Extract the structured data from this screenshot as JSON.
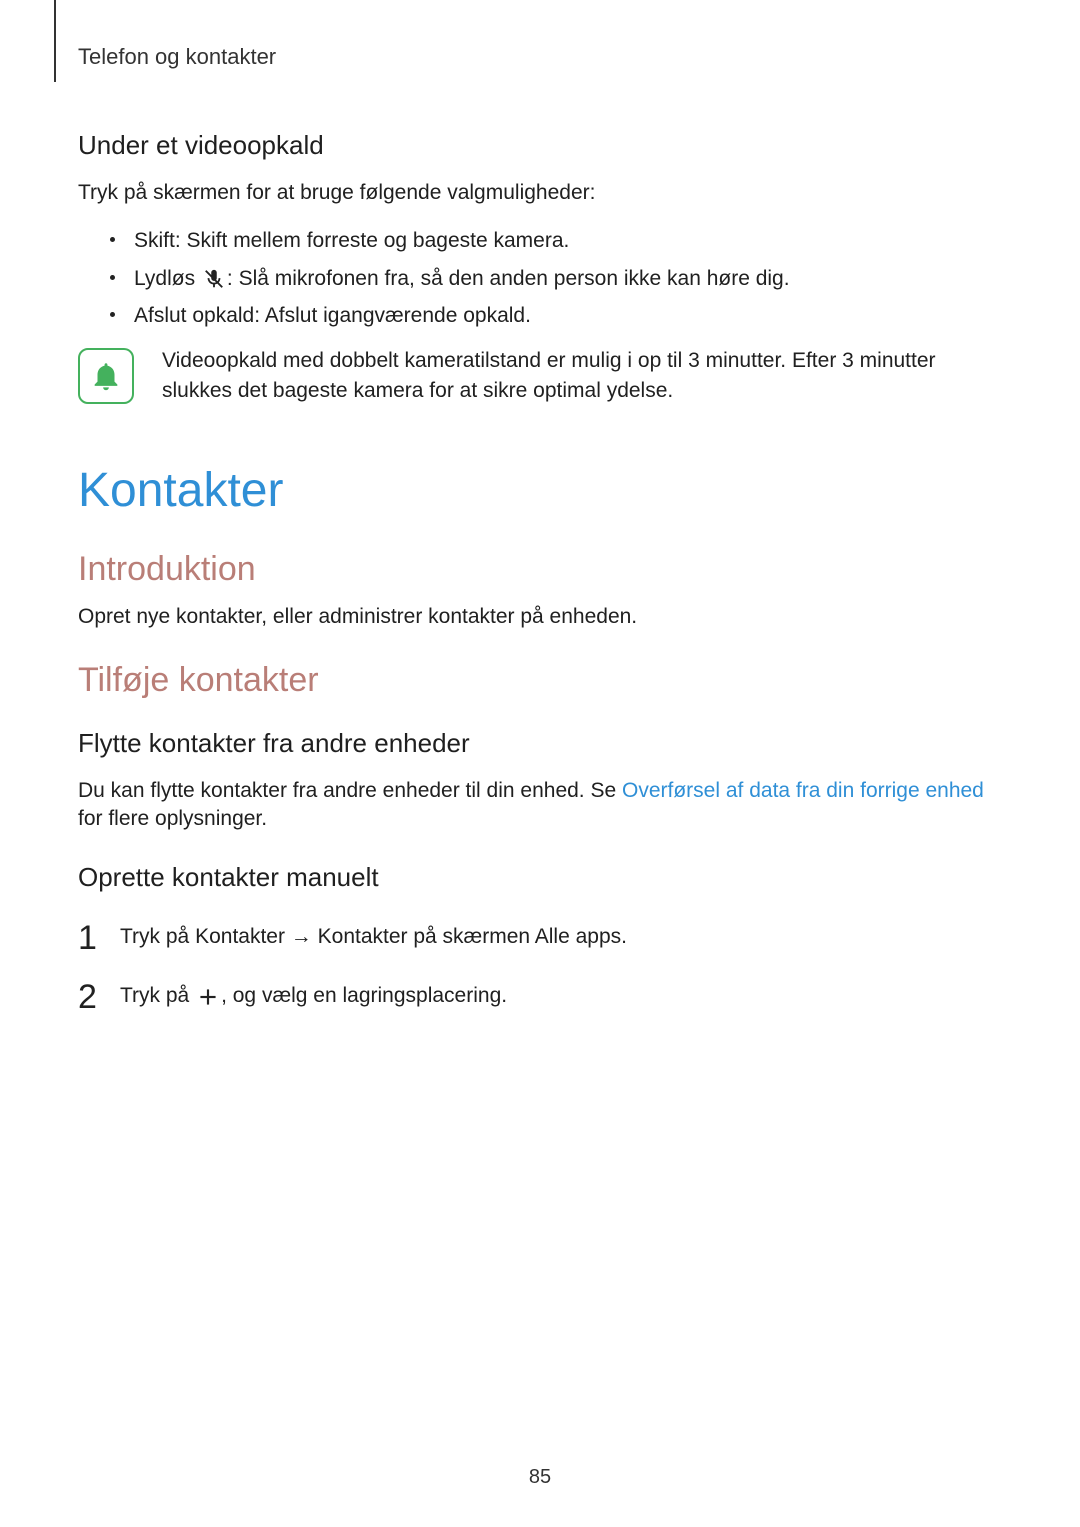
{
  "header": {
    "chapter": "Telefon og kontakter"
  },
  "section_video": {
    "heading": "Under et videoopkald",
    "intro": "Tryk på skærmen for at bruge følgende valgmuligheder:",
    "items": [
      {
        "label": "Skift",
        "desc": ": Skift mellem forreste og bageste kamera."
      },
      {
        "label": "Lydløs",
        "desc": ": Slå mikrofonen fra, så den anden person ikke kan høre dig."
      },
      {
        "label": "Afslut opkald",
        "desc": ": Afslut igangværende opkald."
      }
    ],
    "note": "Videoopkald med dobbelt kameratilstand er mulig i op til 3 minutter. Efter 3 minutter slukkes det bageste kamera for at sikre optimal ydelse."
  },
  "section_contacts": {
    "title": "Kontakter",
    "intro_heading": "Introduktion",
    "intro_body": "Opret nye kontakter, eller administrer kontakter på enheden.",
    "add_heading": "Tilføje kontakter",
    "move_heading": "Flytte kontakter fra andre enheder",
    "move_body_prefix": "Du kan flytte kontakter fra andre enheder til din enhed. Se ",
    "move_link": "Overførsel af data fra din forrige enhed",
    "move_body_suffix": " for flere oplysninger.",
    "manual_heading": "Oprette kontakter manuelt",
    "steps": [
      {
        "num": "1",
        "pre": "Tryk på ",
        "bold1": "Kontakter",
        "mid": " → ",
        "bold2": "Kontakter",
        "post": " på skærmen Alle apps."
      },
      {
        "num": "2",
        "pre": "Tryk på ",
        "post": ", og vælg en lagringsplacering."
      }
    ]
  },
  "page_number": "85"
}
